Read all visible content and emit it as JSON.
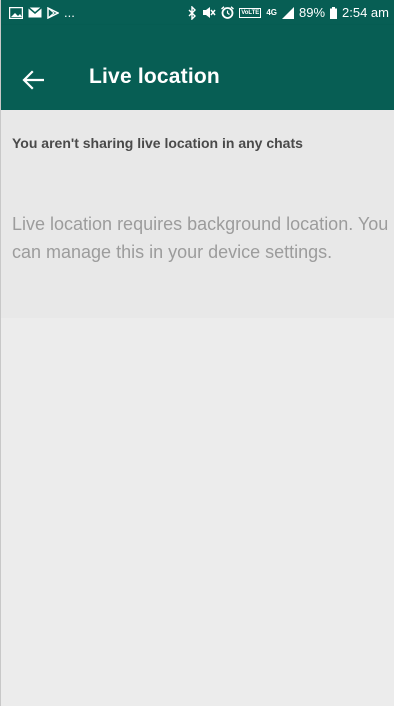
{
  "status_bar": {
    "icons_left": [
      "image-icon",
      "mail-icon",
      "play-store-icon"
    ],
    "overflow": "...",
    "icons_right": [
      "bluetooth-icon",
      "mute-icon",
      "alarm-icon",
      "volte-icon",
      "4g-icon",
      "signal-icon"
    ],
    "volte_label": "VoLTE",
    "network_label": "4G",
    "battery": "89%",
    "time": "2:54 am"
  },
  "app_bar": {
    "back_icon": "arrow-back-icon",
    "title": "Live location",
    "background_color": "#075e54"
  },
  "content": {
    "headline": "You aren't sharing live location in any chats",
    "body": "Live location requires background location. You can manage this in your device settings."
  }
}
